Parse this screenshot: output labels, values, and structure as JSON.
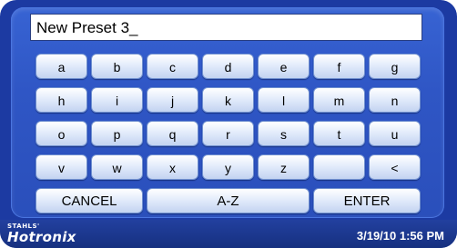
{
  "input": {
    "value": "New Preset 3_"
  },
  "keyboard": {
    "rows": [
      [
        "a",
        "b",
        "c",
        "d",
        "e",
        "f",
        "g"
      ],
      [
        "h",
        "i",
        "j",
        "k",
        "l",
        "m",
        "n"
      ],
      [
        "o",
        "p",
        "q",
        "r",
        "s",
        "t",
        "u"
      ],
      [
        "v",
        "w",
        "x",
        "y",
        "z",
        "",
        "<"
      ]
    ],
    "cancel_label": "CANCEL",
    "sort_label": "A-Z",
    "enter_label": "ENTER"
  },
  "footer": {
    "brand_small": "STAHLS'",
    "brand_large": "Hotronix",
    "datetime": "3/19/10  1:56 PM"
  },
  "colors": {
    "background": "#1c3aa2",
    "panel": "#2f56c5",
    "key_face": "#e3ecfb"
  }
}
